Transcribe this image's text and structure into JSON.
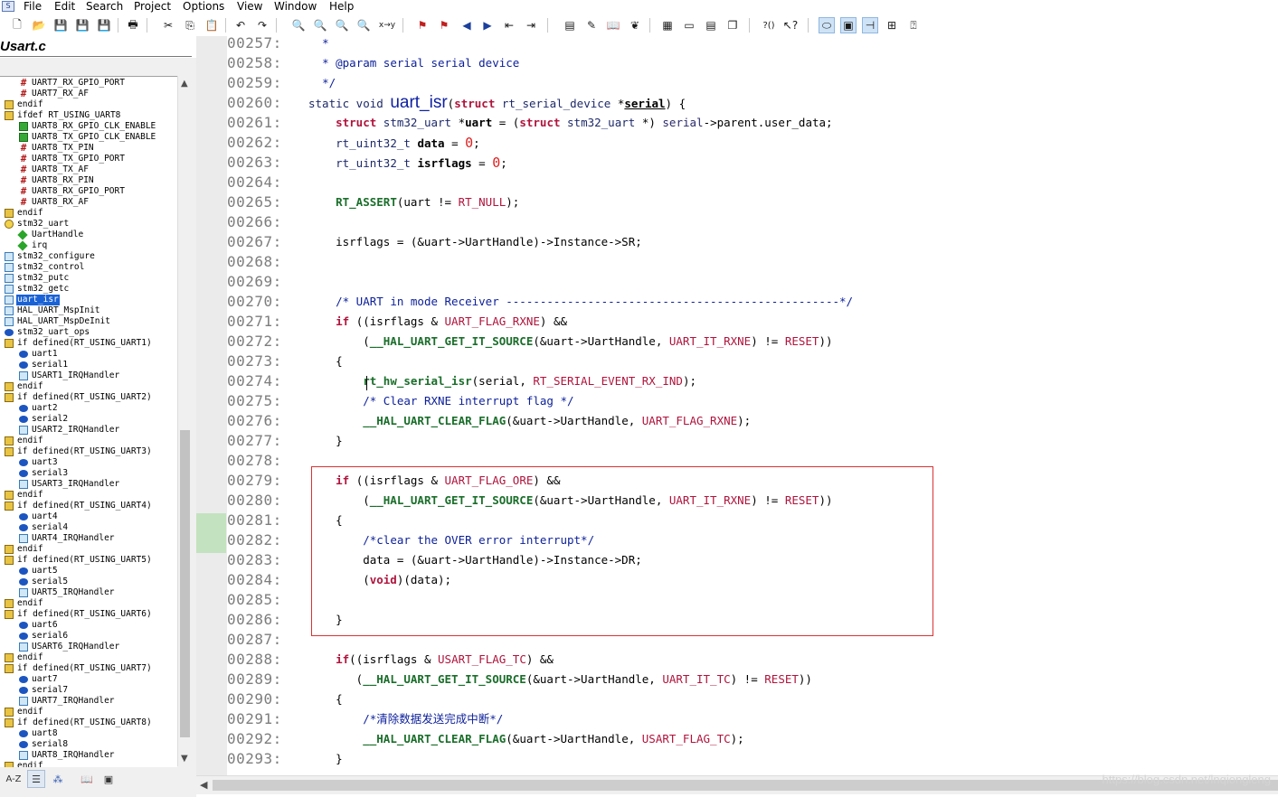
{
  "menu": [
    "File",
    "Edit",
    "Search",
    "Project",
    "Options",
    "View",
    "Window",
    "Help"
  ],
  "file_title": "Usart.c",
  "tree_items": [
    {
      "label": "UART7_RX_GPIO_PORT",
      "icon": "macro",
      "indent": 1
    },
    {
      "label": "UART7_RX_AF",
      "icon": "macro",
      "indent": 1
    },
    {
      "label": "endif",
      "icon": "cond",
      "indent": 0
    },
    {
      "label": "ifdef RT_USING_UART8",
      "icon": "cond",
      "indent": 0
    },
    {
      "label": "UART8_RX_GPIO_CLK_ENABLE",
      "icon": "macro-func",
      "indent": 1
    },
    {
      "label": "UART8_TX_GPIO_CLK_ENABLE",
      "icon": "macro-func",
      "indent": 1
    },
    {
      "label": "UART8_TX_PIN",
      "icon": "macro",
      "indent": 1
    },
    {
      "label": "UART8_TX_GPIO_PORT",
      "icon": "macro",
      "indent": 1
    },
    {
      "label": "UART8_TX_AF",
      "icon": "macro",
      "indent": 1
    },
    {
      "label": "UART8_RX_PIN",
      "icon": "macro",
      "indent": 1
    },
    {
      "label": "UART8_RX_GPIO_PORT",
      "icon": "macro",
      "indent": 1
    },
    {
      "label": "UART8_RX_AF",
      "icon": "macro",
      "indent": 1
    },
    {
      "label": "endif",
      "icon": "cond",
      "indent": 0
    },
    {
      "label": "stm32_uart",
      "icon": "struct",
      "indent": 0
    },
    {
      "label": "UartHandle",
      "icon": "member",
      "indent": 1
    },
    {
      "label": "irq",
      "icon": "member",
      "indent": 1
    },
    {
      "label": "stm32_configure",
      "icon": "func",
      "indent": 0
    },
    {
      "label": "stm32_control",
      "icon": "func",
      "indent": 0
    },
    {
      "label": "stm32_putc",
      "icon": "func",
      "indent": 0
    },
    {
      "label": "stm32_getc",
      "icon": "func",
      "indent": 0
    },
    {
      "label": "uart_isr",
      "icon": "func",
      "indent": 0,
      "selected": true
    },
    {
      "label": "HAL_UART_MspInit",
      "icon": "func",
      "indent": 0
    },
    {
      "label": "HAL_UART_MspDeInit",
      "icon": "func",
      "indent": 0
    },
    {
      "label": "stm32_uart_ops",
      "icon": "var",
      "indent": 0
    },
    {
      "label": "if defined(RT_USING_UART1)",
      "icon": "cond",
      "indent": 0
    },
    {
      "label": "uart1",
      "icon": "var",
      "indent": 1
    },
    {
      "label": "serial1",
      "icon": "var",
      "indent": 1
    },
    {
      "label": "USART1_IRQHandler",
      "icon": "func",
      "indent": 1
    },
    {
      "label": "endif",
      "icon": "cond",
      "indent": 0
    },
    {
      "label": "if defined(RT_USING_UART2)",
      "icon": "cond",
      "indent": 0
    },
    {
      "label": "uart2",
      "icon": "var",
      "indent": 1
    },
    {
      "label": "serial2",
      "icon": "var",
      "indent": 1
    },
    {
      "label": "USART2_IRQHandler",
      "icon": "func",
      "indent": 1
    },
    {
      "label": "endif",
      "icon": "cond",
      "indent": 0
    },
    {
      "label": "if defined(RT_USING_UART3)",
      "icon": "cond",
      "indent": 0
    },
    {
      "label": "uart3",
      "icon": "var",
      "indent": 1
    },
    {
      "label": "serial3",
      "icon": "var",
      "indent": 1
    },
    {
      "label": "USART3_IRQHandler",
      "icon": "func",
      "indent": 1
    },
    {
      "label": "endif",
      "icon": "cond",
      "indent": 0
    },
    {
      "label": "if defined(RT_USING_UART4)",
      "icon": "cond",
      "indent": 0
    },
    {
      "label": "uart4",
      "icon": "var",
      "indent": 1
    },
    {
      "label": "serial4",
      "icon": "var",
      "indent": 1
    },
    {
      "label": "UART4_IRQHandler",
      "icon": "func",
      "indent": 1
    },
    {
      "label": "endif",
      "icon": "cond",
      "indent": 0
    },
    {
      "label": "if defined(RT_USING_UART5)",
      "icon": "cond",
      "indent": 0
    },
    {
      "label": "uart5",
      "icon": "var",
      "indent": 1
    },
    {
      "label": "serial5",
      "icon": "var",
      "indent": 1
    },
    {
      "label": "UART5_IRQHandler",
      "icon": "func",
      "indent": 1
    },
    {
      "label": "endif",
      "icon": "cond",
      "indent": 0
    },
    {
      "label": "if defined(RT_USING_UART6)",
      "icon": "cond",
      "indent": 0
    },
    {
      "label": "uart6",
      "icon": "var",
      "indent": 1
    },
    {
      "label": "serial6",
      "icon": "var",
      "indent": 1
    },
    {
      "label": "USART6_IRQHandler",
      "icon": "func",
      "indent": 1
    },
    {
      "label": "endif",
      "icon": "cond",
      "indent": 0
    },
    {
      "label": "if defined(RT_USING_UART7)",
      "icon": "cond",
      "indent": 0
    },
    {
      "label": "uart7",
      "icon": "var",
      "indent": 1
    },
    {
      "label": "serial7",
      "icon": "var",
      "indent": 1
    },
    {
      "label": "UART7_IRQHandler",
      "icon": "func",
      "indent": 1
    },
    {
      "label": "endif",
      "icon": "cond",
      "indent": 0
    },
    {
      "label": "if defined(RT_USING_UART8)",
      "icon": "cond",
      "indent": 0
    },
    {
      "label": "uart8",
      "icon": "var",
      "indent": 1
    },
    {
      "label": "serial8",
      "icon": "var",
      "indent": 1
    },
    {
      "label": "UART8_IRQHandler",
      "icon": "func",
      "indent": 1
    },
    {
      "label": "endif",
      "icon": "cond",
      "indent": 0
    }
  ],
  "code_lines": [
    {
      "n": "00257:",
      "html": "  <span class='cm'>*</span>"
    },
    {
      "n": "00258:",
      "html": "  <span class='cm'>* @param serial serial device</span>"
    },
    {
      "n": "00259:",
      "html": "  <span class='cm'>*/</span>"
    },
    {
      "n": "00260:",
      "html": "<span class='ty'>static void </span><span class='defname'>uart_isr</span>(<span class='kw'>struct</span> <span class='ty'>rt_serial_device</span> *<span style='font-weight:bold;text-decoration:underline'>serial</span>) {"
    },
    {
      "n": "00261:",
      "html": "    <span class='kw'>struct</span> <span class='ty'>stm32_uart</span> *<span style='font-weight:bold'>uart</span> = (<span class='kw'>struct</span> <span class='ty'>stm32_uart</span> *) <span class='fld'>serial</span>-&gt;parent.user_data;"
    },
    {
      "n": "00262:",
      "html": "    <span class='ty'>rt_uint32_t</span> <span style='font-weight:bold'>data</span> = <span class='num'>0</span>;"
    },
    {
      "n": "00263:",
      "html": "    <span class='ty'>rt_uint32_t</span> <span style='font-weight:bold'>isrflags</span> = <span class='num'>0</span>;"
    },
    {
      "n": "00264:",
      "html": ""
    },
    {
      "n": "00265:",
      "html": "    <span class='fn'>RT_ASSERT</span>(uart != <span class='mac'>RT_NULL</span>);"
    },
    {
      "n": "00266:",
      "html": ""
    },
    {
      "n": "00267:",
      "html": "    isrflags = (&amp;uart-&gt;UartHandle)-&gt;Instance-&gt;SR;"
    },
    {
      "n": "00268:",
      "html": ""
    },
    {
      "n": "00269:",
      "html": ""
    },
    {
      "n": "00270:",
      "html": "    <span class='cm'>/* UART in mode Receiver -------------------------------------------------*/</span>"
    },
    {
      "n": "00271:",
      "html": "    <span class='kw'>if</span> ((isrflags &amp; <span class='mac'>UART_FLAG_RXNE</span>) &amp;&amp;"
    },
    {
      "n": "00272:",
      "html": "        (<span class='fn'>__HAL_UART_GET_IT_SOURCE</span>(&amp;uart-&gt;UartHandle, <span class='mac'>UART_IT_RXNE</span>) != <span class='mac'>RESET</span>))"
    },
    {
      "n": "00273:",
      "html": "    {"
    },
    {
      "n": "00274:",
      "html": "        <span class='fn'>rt_hw_serial_isr</span>(serial, <span class='mac'>RT_SERIAL_EVENT_RX_IND</span>);"
    },
    {
      "n": "00275:",
      "html": "        <span class='cm'>/* Clear RXNE interrupt flag */</span>"
    },
    {
      "n": "00276:",
      "html": "        <span class='fn'>__HAL_UART_CLEAR_FLAG</span>(&amp;uart-&gt;UartHandle, <span class='mac'>UART_FLAG_RXNE</span>);"
    },
    {
      "n": "00277:",
      "html": "    }"
    },
    {
      "n": "00278:",
      "html": ""
    },
    {
      "n": "00279:",
      "html": "    <span class='kw'>if</span> ((isrflags &amp; <span class='mac'>UART_FLAG_ORE</span>) &amp;&amp;"
    },
    {
      "n": "00280:",
      "html": "        (<span class='fn'>__HAL_UART_GET_IT_SOURCE</span>(&amp;uart-&gt;UartHandle, <span class='mac'>UART_IT_RXNE</span>) != <span class='mac'>RESET</span>))"
    },
    {
      "n": "00281:",
      "html": "    {"
    },
    {
      "n": "00282:",
      "html": "        <span class='cm'>/*clear the OVER error interrupt*/</span>"
    },
    {
      "n": "00283:",
      "html": "        data = (&amp;uart-&gt;UartHandle)-&gt;Instance-&gt;DR;"
    },
    {
      "n": "00284:",
      "html": "        (<span class='kw'>void</span>)(data);"
    },
    {
      "n": "00285:",
      "html": ""
    },
    {
      "n": "00286:",
      "html": "    }"
    },
    {
      "n": "00287:",
      "html": ""
    },
    {
      "n": "00288:",
      "html": "    <span class='kw'>if</span>((isrflags &amp; <span class='mac'>USART_FLAG_TC</span>) &amp;&amp;"
    },
    {
      "n": "00289:",
      "html": "       (<span class='fn'>__HAL_UART_GET_IT_SOURCE</span>(&amp;uart-&gt;UartHandle, <span class='mac'>UART_IT_TC</span>) != <span class='mac'>RESET</span>))"
    },
    {
      "n": "00290:",
      "html": "    {"
    },
    {
      "n": "00291:",
      "html": "        <span class='cm'>/*清除数据发送完成中断*/</span>"
    },
    {
      "n": "00292:",
      "html": "        <span class='fn'>__HAL_UART_CLEAR_FLAG</span>(&amp;uart-&gt;UartHandle, <span class='mac'>USART_FLAG_TC</span>);"
    },
    {
      "n": "00293:",
      "html": "    }"
    }
  ],
  "watermark": "https://blog.csdn.net/lnqiongleng",
  "colors": {
    "selection": "#1a62d6",
    "highlight_box": "#d83333",
    "gutter_mark": "#c3e2bf"
  }
}
